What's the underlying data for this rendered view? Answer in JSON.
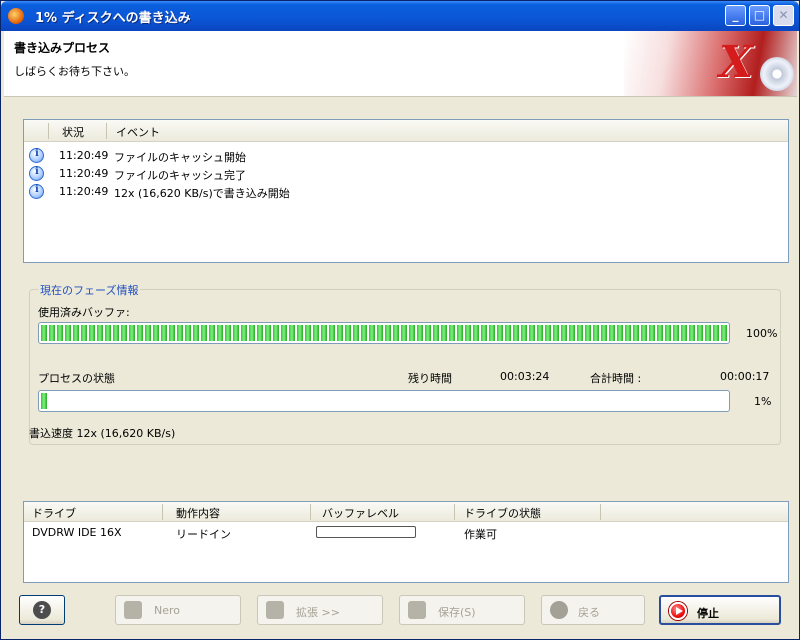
{
  "window": {
    "title": "1% ディスクへの書き込み"
  },
  "header": {
    "title": "書き込みプロセス",
    "subtitle": "しばらくお待ち下さい。"
  },
  "events": {
    "columns": [
      "状況",
      "イベント"
    ],
    "rows": [
      {
        "icon": "info-icon",
        "time": "11:20:49",
        "text": "ファイルのキャッシュ開始"
      },
      {
        "icon": "info-icon",
        "time": "11:20:49",
        "text": "ファイルのキャッシュ完了"
      },
      {
        "icon": "info-icon",
        "time": "11:20:49",
        "text": "12x (16,620 KB/s)で書き込み開始"
      }
    ]
  },
  "phase": {
    "legend": "現在のフェーズ情報",
    "buffer_label": "使用済みバッファ:",
    "buffer_percent_text": "100%",
    "buffer_fraction": 1.0,
    "process_label": "プロセスの状態",
    "remaining_label": "残り時間",
    "remaining_value": "00:03:24",
    "total_label": "合計時間 :",
    "total_value": "00:00:17",
    "process_percent_text": "1%",
    "process_fraction": 0.01
  },
  "write_speed": "書込速度 12x (16,620 KB/s)",
  "drives": {
    "columns": [
      "ドライブ",
      "動作内容",
      "バッファレベル",
      "ドライブの状態"
    ],
    "rows": [
      {
        "drive": "DVDRW IDE 16X",
        "action": "リードイン",
        "status": "作業可"
      }
    ]
  },
  "buttons": {
    "nero": "Nero",
    "expand": "拡張 >>",
    "save": "保存(S)",
    "back": "戻る",
    "stop": "停止"
  }
}
